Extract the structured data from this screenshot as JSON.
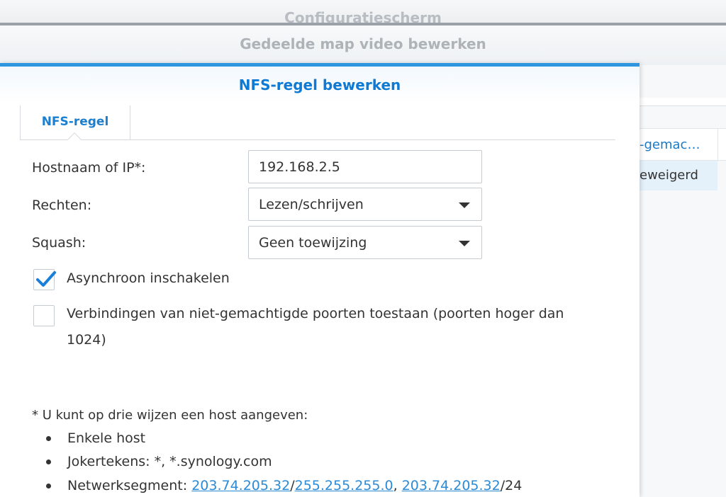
{
  "background": {
    "window1_title": "Configuratiescherm",
    "window2_title": "Gedeelde map video bewerken",
    "table_header": "-gemac…",
    "table_row": "eweigerd"
  },
  "dialog": {
    "title": "NFS-regel bewerken",
    "tabs": [
      {
        "label": "NFS-regel"
      }
    ],
    "fields": {
      "host": {
        "label": "Hostnaam of IP*:",
        "value": "192.168.2.5"
      },
      "rights": {
        "label": "Rechten:",
        "value": "Lezen/schrijven"
      },
      "squash": {
        "label": "Squash:",
        "value": "Geen toewijzing"
      }
    },
    "checkboxes": {
      "async": {
        "label": "Asynchroon inschakelen",
        "checked": true
      },
      "unprivileged": {
        "label_line1": "Verbindingen van niet-gemachtigde poorten toestaan (poorten hoger dan",
        "label_line2": "1024)",
        "checked": false
      }
    },
    "note": {
      "intro": "* U kunt op drie wijzen een host aangeven:",
      "single_host": "Enkele host",
      "wildcards": "Jokertekens: *, *.synology.com",
      "segment_label": "Netwerksegment: ",
      "segment_link1": "203.74.205.32",
      "slash1": "/",
      "segment_link2": "255.255.255.0",
      "comma": ", ",
      "segment_link3": "203.74.205.32",
      "slash_suffix": "/24"
    },
    "colors": {
      "accent": "#2e95e0",
      "title": "#0f7ad4",
      "link": "#2a8ad6",
      "check": "#1a7fd8"
    }
  }
}
